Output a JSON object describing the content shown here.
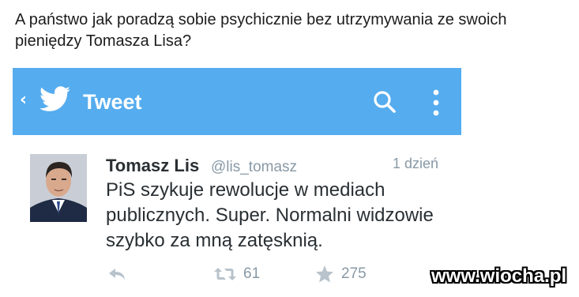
{
  "post": {
    "caption": "A państwo jak poradzą sobie psychicznie bez utrzymywania ze swoich pieniędzy Tomasza Lisa?"
  },
  "twitter": {
    "header": {
      "title": "Tweet",
      "back_icon": "back-chevron-icon",
      "logo_icon": "twitter-bird-icon",
      "search_icon": "search-icon",
      "more_icon": "overflow-menu-icon",
      "bar_color": "#55acee"
    },
    "tweet": {
      "author_name": "Tomasz Lis",
      "author_handle": "@lis_tomasz",
      "timestamp": "1 dzień",
      "text": "PiS szykuje rewolucje w mediach publicznych. Super. Normalni widzowie szybko za mną zatęsknią.",
      "retweet_count": "61",
      "favorite_count": "275"
    }
  },
  "watermark": {
    "text": "www.wiocha.pl"
  }
}
